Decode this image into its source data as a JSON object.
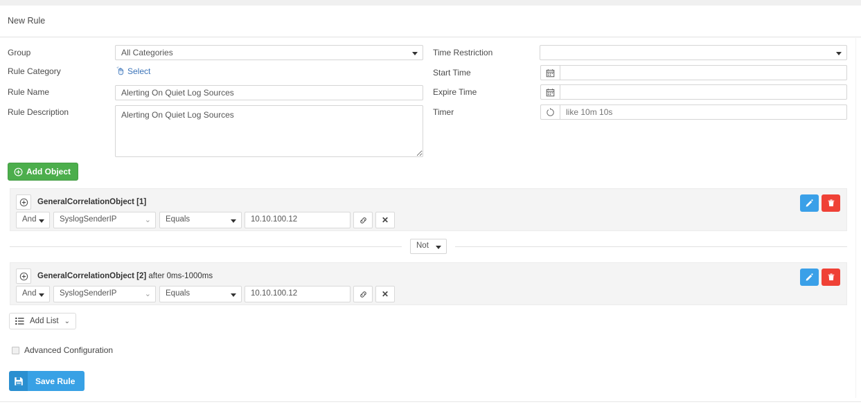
{
  "header": {
    "title": "New Rule"
  },
  "form": {
    "left": {
      "group": {
        "label": "Group",
        "value": "All Categories"
      },
      "rule_category": {
        "label": "Rule Category",
        "link_text": "Select",
        "icon": "hand-pointer-icon"
      },
      "rule_name": {
        "label": "Rule Name",
        "value": "Alerting On Quiet Log Sources",
        "placeholder": ""
      },
      "rule_description": {
        "label": "Rule Description",
        "value": "Alerting On Quiet Log Sources",
        "placeholder": ""
      }
    },
    "right": {
      "time_restriction": {
        "label": "Time Restriction",
        "value": ""
      },
      "start_time": {
        "label": "Start Time",
        "value": "",
        "placeholder": "",
        "icon": "calendar-icon"
      },
      "expire_time": {
        "label": "Expire Time",
        "value": "",
        "placeholder": "",
        "icon": "calendar-icon"
      },
      "timer": {
        "label": "Timer",
        "value": "",
        "placeholder": "like 10m 10s",
        "icon": "timer-icon"
      }
    }
  },
  "buttons": {
    "add_object": {
      "label": "Add Object",
      "icon": "plus-circle-icon",
      "color": "#4cae4c"
    },
    "add_list": {
      "label": "Add List",
      "icon": "list-icon",
      "caret": "chevron-down-icon"
    },
    "save_rule": {
      "label": "Save Rule",
      "icon": "floppy-disk-icon",
      "color": "#38a1e5"
    }
  },
  "objects": [
    {
      "title": "GeneralCorrelationObject [1]",
      "title_suffix": "",
      "expand_icon": "plus-circle-icon",
      "edit_icon": "pencil-icon",
      "delete_icon": "trash-icon",
      "condition": {
        "logic": "And",
        "field": "SyslogSenderIP",
        "operator": "Equals",
        "value": "10.10.100.12",
        "link_icon": "chain-link-icon",
        "remove_icon": "close-icon"
      }
    },
    {
      "title": "GeneralCorrelationObject [2]",
      "title_suffix": " after 0ms-1000ms",
      "expand_icon": "plus-circle-icon",
      "edit_icon": "pencil-icon",
      "delete_icon": "trash-icon",
      "condition": {
        "logic": "And",
        "field": "SyslogSenderIP",
        "operator": "Equals",
        "value": "10.10.100.12",
        "link_icon": "chain-link-icon",
        "remove_icon": "close-icon"
      }
    }
  ],
  "joiner": {
    "value": "Not"
  },
  "advanced_configuration": {
    "label": "Advanced Configuration",
    "checked": false
  },
  "colors": {
    "link": "#3a73b8",
    "green": "#4cae4c",
    "blue": "#38a1e5",
    "red": "#ef4136",
    "panel_bg": "#f4f4f4"
  }
}
